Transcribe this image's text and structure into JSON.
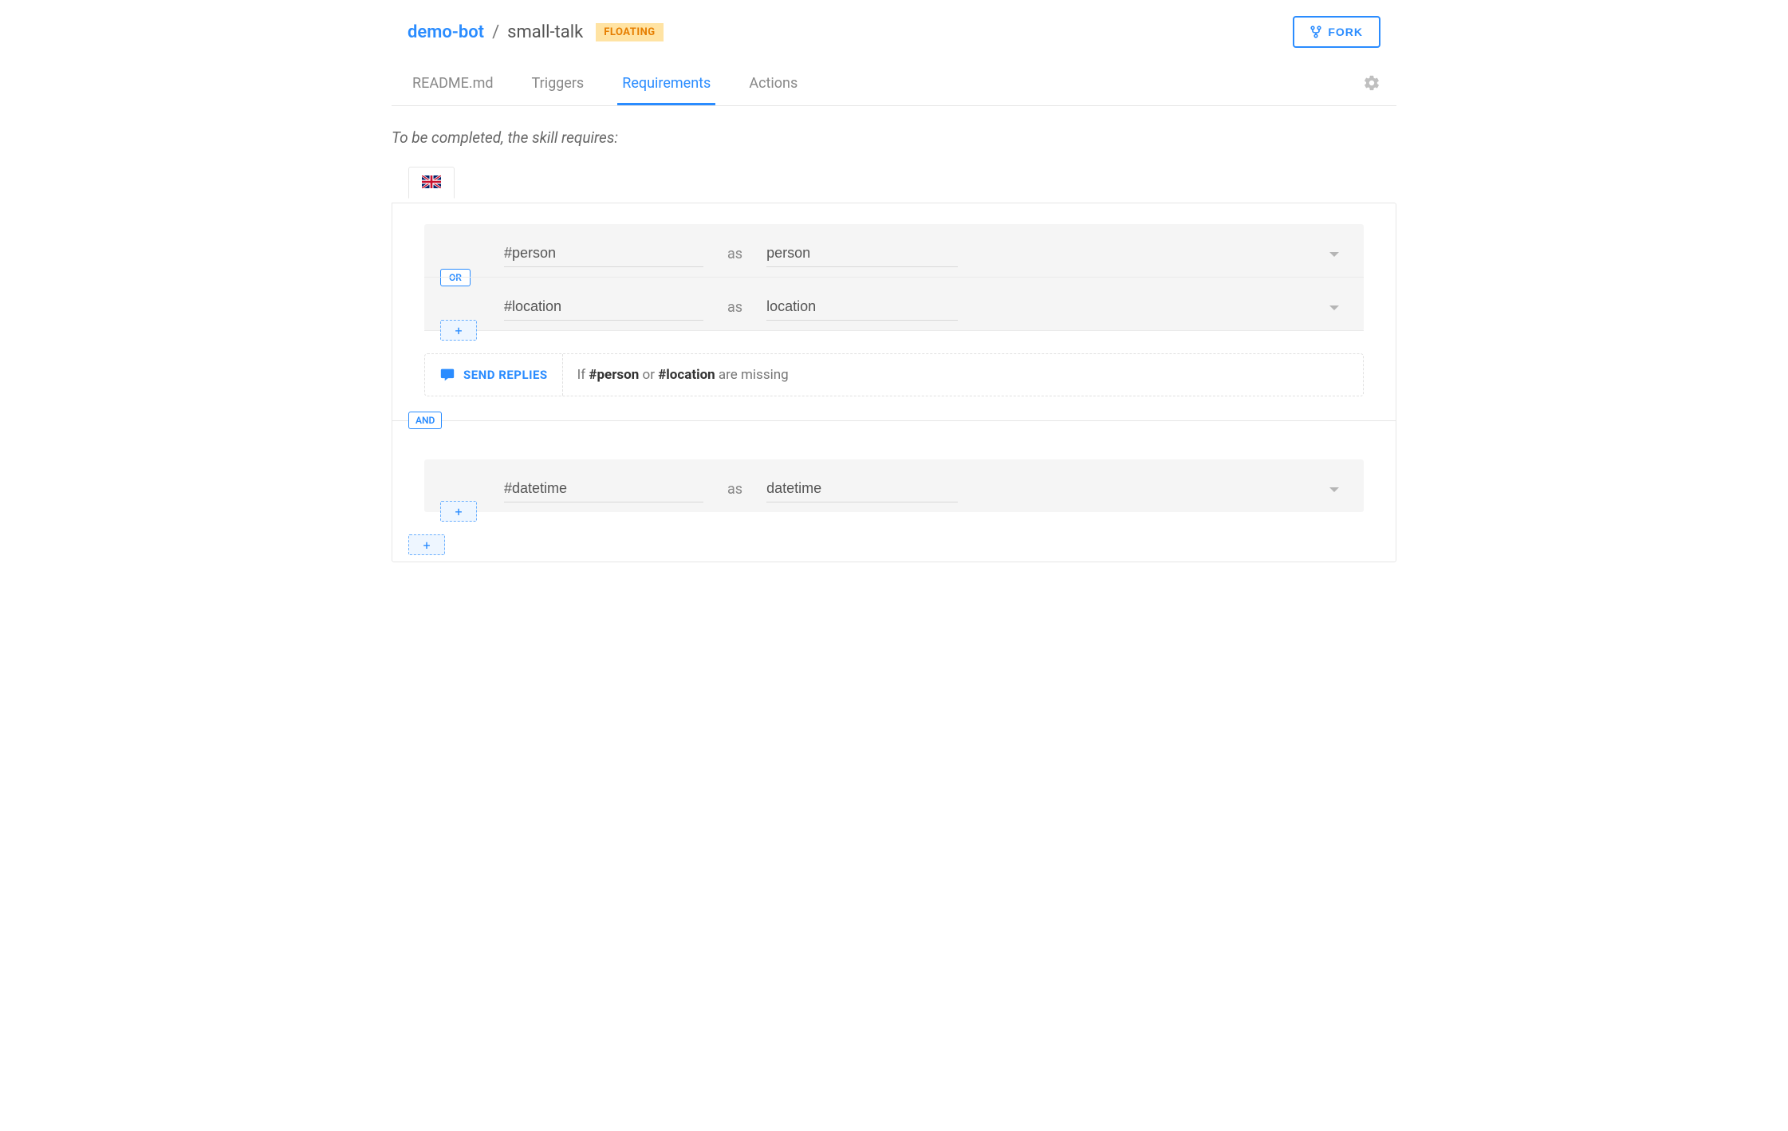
{
  "breadcrumb": {
    "bot": "demo-bot",
    "sep": "/",
    "skill": "small-talk"
  },
  "badge": "FLOATING",
  "fork_label": "FORK",
  "tabs": [
    "README.md",
    "Triggers",
    "Requirements",
    "Actions"
  ],
  "active_tab": 2,
  "intro": "To be completed, the skill requires:",
  "groups": [
    {
      "logic": "OR",
      "rows": [
        {
          "entity": "#person",
          "asLabel": "as",
          "alias": "person"
        },
        {
          "entity": "#location",
          "asLabel": "as",
          "alias": "location"
        }
      ],
      "send": {
        "label": "SEND REPLIES",
        "if": "If",
        "tokens": [
          "#person",
          "or",
          "#location"
        ],
        "tail": "are missing"
      }
    },
    {
      "logic_before": "AND",
      "rows": [
        {
          "entity": "#datetime",
          "asLabel": "as",
          "alias": "datetime"
        }
      ]
    }
  ],
  "plus": "+"
}
